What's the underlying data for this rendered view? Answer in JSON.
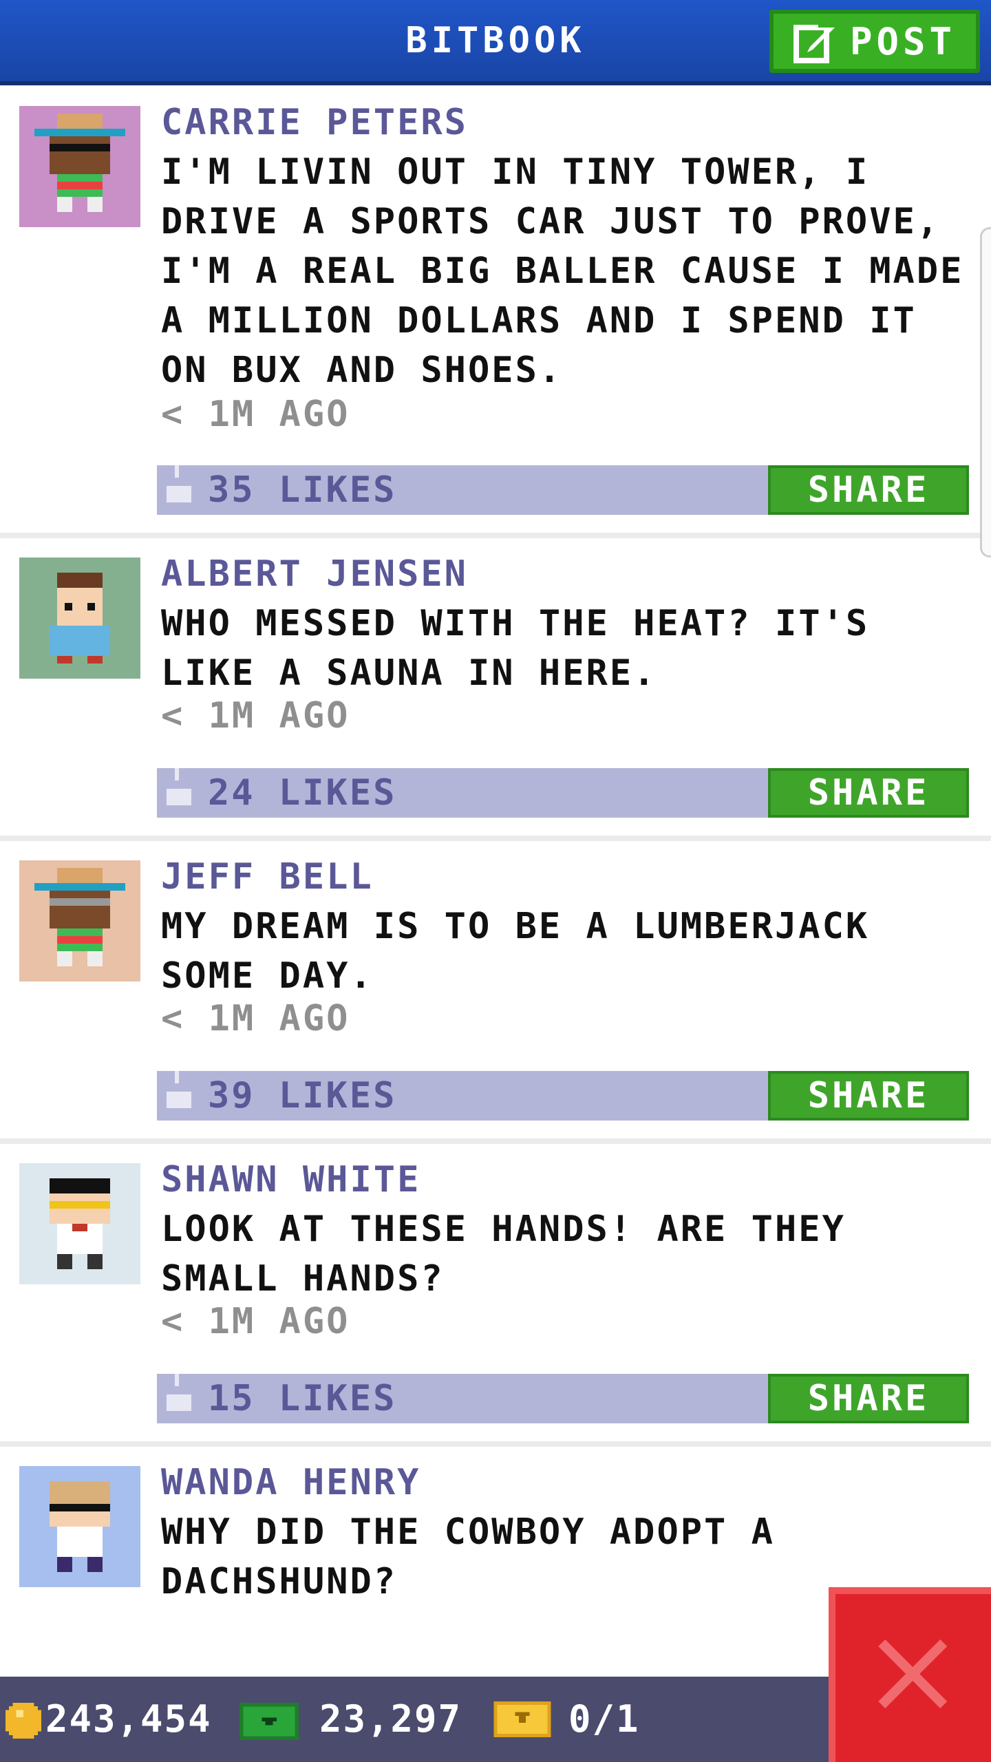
{
  "header": {
    "title": "BITBOOK",
    "post_label": "POST"
  },
  "posts": [
    {
      "author": "CARRIE PETERS",
      "text": "I'M LIVIN OUT IN TINY TOWER, I DRIVE A SPORTS CAR JUST TO PROVE, I'M A REAL BIG BALLER CAUSE I MADE A MILLION DOLLARS AND I SPEND IT ON BUX AND SHOES.",
      "time": "< 1M AGO",
      "likes": "35 LIKES",
      "share": "SHARE",
      "avatar_bg": "#c98fc7"
    },
    {
      "author": "ALBERT JENSEN",
      "text": "WHO MESSED WITH THE HEAT? IT'S LIKE A SAUNA IN HERE.",
      "time": "< 1M AGO",
      "likes": "24 LIKES",
      "share": "SHARE",
      "avatar_bg": "#85b08f"
    },
    {
      "author": "JEFF BELL",
      "text": "MY DREAM IS TO BE A LUMBERJACK SOME DAY.",
      "time": "< 1M AGO",
      "likes": "39 LIKES",
      "share": "SHARE",
      "avatar_bg": "#e8c1a6"
    },
    {
      "author": "SHAWN WHITE",
      "text": "LOOK AT THESE HANDS! ARE THEY SMALL HANDS?",
      "time": "< 1M AGO",
      "likes": "15 LIKES",
      "share": "SHARE",
      "avatar_bg": "#dce8ee"
    },
    {
      "author": "WANDA HENRY",
      "text": "WHY DID THE COWBOY ADOPT A DACHSHUND?",
      "avatar_bg": "#a7bfee"
    }
  ],
  "footer": {
    "coins": "243,454",
    "bux": "23,297",
    "tickets": "0/1"
  },
  "colors": {
    "header_blue": "#1f56c8",
    "post_green": "#39b024",
    "like_bar": "#b3b5d8",
    "author_purple": "#5a5897",
    "share_green": "#3fa52a",
    "footer_bg": "#4a4b6d",
    "close_red": "#e0232b"
  },
  "icons": {
    "post": "edit-icon",
    "like": "thumbs-up-icon",
    "coin": "coin-icon",
    "bux": "bux-icon",
    "ticket": "ticket-icon",
    "close": "close-icon"
  }
}
